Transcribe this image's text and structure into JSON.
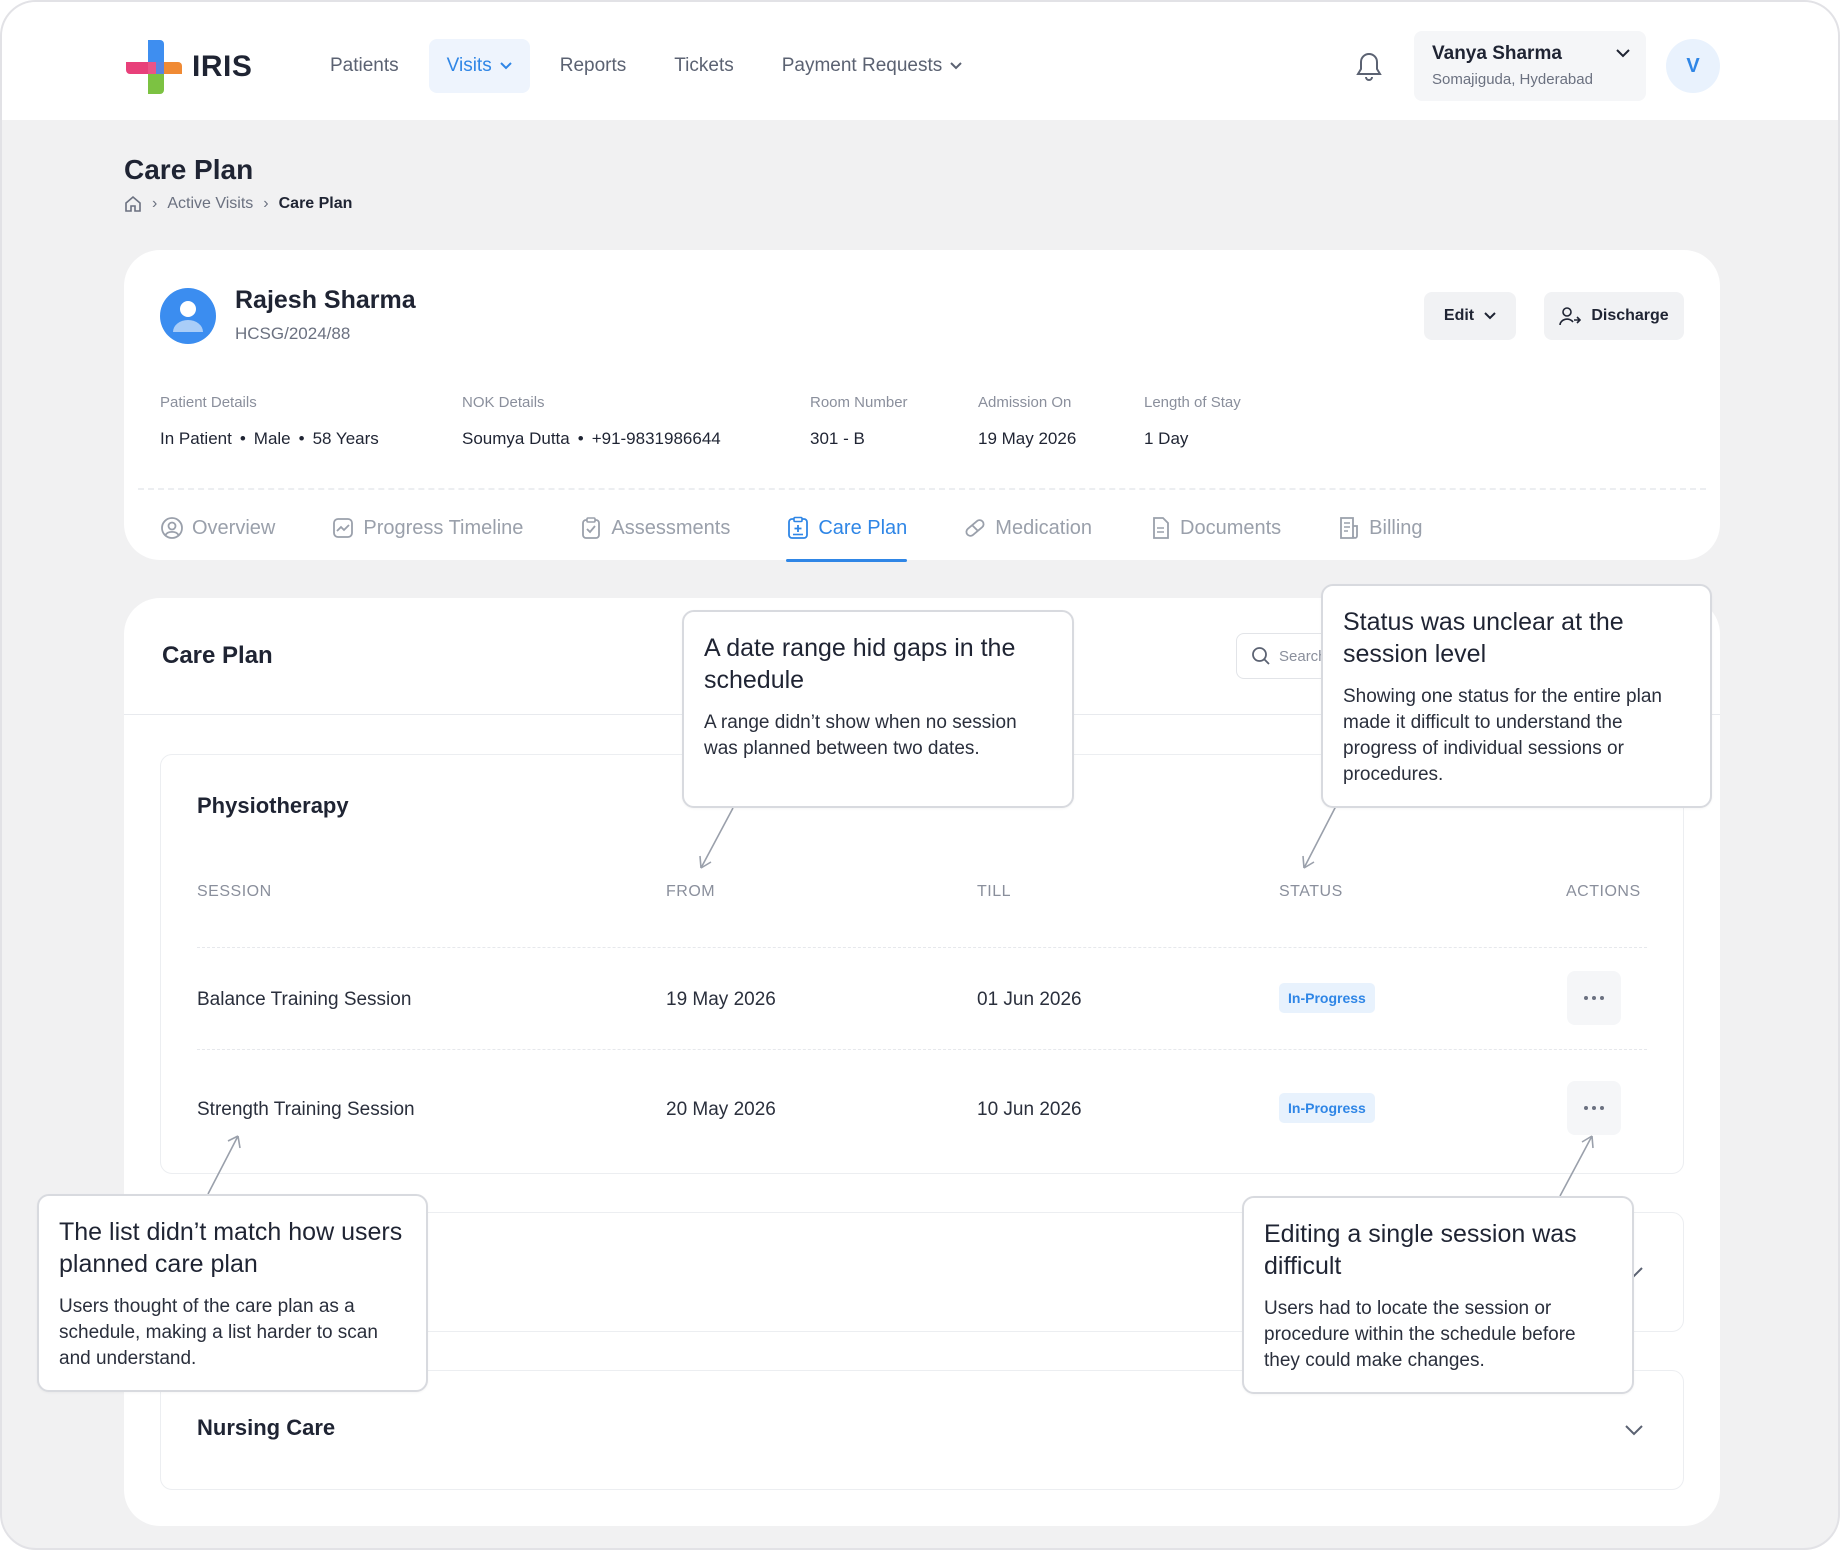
{
  "app": {
    "name": "IRIS"
  },
  "nav": {
    "items": [
      {
        "label": "Patients",
        "active": false,
        "has_menu": false
      },
      {
        "label": "Visits",
        "active": true,
        "has_menu": true
      },
      {
        "label": "Reports",
        "active": false,
        "has_menu": false
      },
      {
        "label": "Tickets",
        "active": false,
        "has_menu": false
      },
      {
        "label": "Payment Requests",
        "active": false,
        "has_menu": true
      }
    ]
  },
  "user": {
    "name": "Vanya Sharma",
    "location": "Somajiguda, Hyderabad",
    "initial": "V"
  },
  "page": {
    "title": "Care Plan"
  },
  "breadcrumb": {
    "items": [
      "Active Visits",
      "Care Plan"
    ]
  },
  "patient": {
    "name": "Rajesh Sharma",
    "id": "HCSG/2024/88",
    "edit_label": "Edit",
    "discharge_label": "Discharge",
    "details": {
      "patient_label": "Patient Details",
      "patient_type": "In Patient",
      "gender": "Male",
      "age": "58 Years",
      "nok_label": "NOK Details",
      "nok_name": "Soumya Dutta",
      "nok_phone": "+91-9831986644",
      "room_label": "Room Number",
      "room": "301 - B",
      "admission_label": "Admission On",
      "admission": "19 May 2026",
      "stay_label": "Length of Stay",
      "stay": "1 Day"
    }
  },
  "tabs": [
    {
      "label": "Overview",
      "icon": "user-circle-icon",
      "active": false
    },
    {
      "label": "Progress Timeline",
      "icon": "chart-icon",
      "active": false
    },
    {
      "label": "Assessments",
      "icon": "clipboard-icon",
      "active": false
    },
    {
      "label": "Care Plan",
      "icon": "care-plan-icon",
      "active": true
    },
    {
      "label": "Medication",
      "icon": "pill-icon",
      "active": false
    },
    {
      "label": "Documents",
      "icon": "document-icon",
      "active": false
    },
    {
      "label": "Billing",
      "icon": "receipt-icon",
      "active": false
    }
  ],
  "care_plan": {
    "title": "Care Plan",
    "search_placeholder": "Search",
    "groups": [
      {
        "title": "Physiotherapy",
        "expanded": true,
        "columns": [
          "SESSION",
          "FROM",
          "TILL",
          "STATUS",
          "ACTIONS"
        ],
        "rows": [
          {
            "session": "Balance Training Session",
            "from": "19 May 2026",
            "till": "01 Jun 2026",
            "status": "In-Progress"
          },
          {
            "session": "Strength Training Session",
            "from": "20 May 2026",
            "till": "10 Jun 2026",
            "status": "In-Progress"
          }
        ]
      },
      {
        "title": "",
        "expanded": false
      },
      {
        "title": "Nursing Care",
        "expanded": false
      }
    ]
  },
  "callouts": [
    {
      "title": "A date range hid gaps in the schedule",
      "body": "A range didn’t show when no session was planned between two dates."
    },
    {
      "title": "Status was unclear at the session level",
      "body": "Showing one status for the entire plan made it difficult to understand the progress of individual sessions or procedures."
    },
    {
      "title": "The list didn’t match how users planned care plan",
      "body": "Users thought of the care plan as a schedule, making a list harder to scan and understand."
    },
    {
      "title": "Editing a single session was difficult",
      "body": "Users had to locate the session or procedure within the schedule before they could make changes."
    }
  ],
  "colors": {
    "accent": "#2f86e6",
    "background": "#f1f1f2",
    "badge_bg": "#e8f2fd"
  }
}
